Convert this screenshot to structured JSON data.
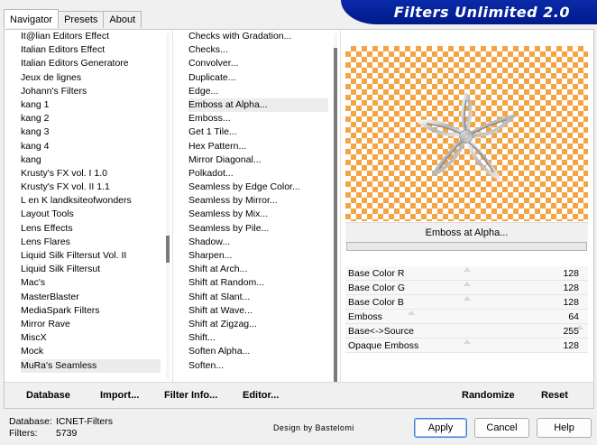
{
  "tabs": [
    "Navigator",
    "Presets",
    "About"
  ],
  "banner_title": "Filters Unlimited 2.0",
  "categories": [
    "It@lian Editors Effect",
    "Italian Editors Effect",
    "Italian Editors Generatore",
    "Jeux de lignes",
    "Johann's Filters",
    "kang 1",
    "kang 2",
    "kang 3",
    "kang 4",
    "kang",
    "Krusty's FX vol. I 1.0",
    "Krusty's FX vol. II 1.1",
    "L en K landksiteofwonders",
    "Layout Tools",
    "Lens Effects",
    "Lens Flares",
    "Liquid Silk Filtersut Vol. II",
    "Liquid Silk Filtersut",
    "Mac's",
    "MasterBlaster",
    "MediaSpark Filters",
    "Mirror Rave",
    "MiscX",
    "Mock",
    "MuRa's Seamless"
  ],
  "selected_category": "MuRa's Seamless",
  "filters": [
    "Checks with Gradation...",
    "Checks...",
    "Convolver...",
    "Duplicate...",
    "Edge...",
    "Emboss at Alpha...",
    "Emboss...",
    "Get 1 Tile...",
    "Hex Pattern...",
    "Mirror Diagonal...",
    "Polkadot...",
    "Seamless by Edge Color...",
    "Seamless by Mirror...",
    "Seamless by Mix...",
    "Seamless by Pile...",
    "Shadow...",
    "Sharpen...",
    "Shift at Arch...",
    "Shift at Random...",
    "Shift at Slant...",
    "Shift at Wave...",
    "Shift at Zigzag...",
    "Shift...",
    "Soften Alpha...",
    "Soften..."
  ],
  "selected_filter": "Emboss at Alpha...",
  "filter_name": "Emboss at Alpha...",
  "params": [
    {
      "label": "Base Color R",
      "value": "128",
      "level": 0.5
    },
    {
      "label": "Base Color G",
      "value": "128",
      "level": 0.5
    },
    {
      "label": "Base Color B",
      "value": "128",
      "level": 0.5
    },
    {
      "label": "Emboss",
      "value": "64",
      "level": 0.25
    },
    {
      "label": "Base<->Source",
      "value": "255",
      "level": 1.0
    },
    {
      "label": "Opaque Emboss",
      "value": "128",
      "level": 0.5
    }
  ],
  "bottom_links": {
    "database": "Database",
    "import": "Import...",
    "filter_info": "Filter Info...",
    "editor": "Editor...",
    "randomize": "Randomize",
    "reset": "Reset"
  },
  "status": {
    "database_label": "Database:",
    "database_value": "ICNET-Filters",
    "filters_label": "Filters:",
    "filters_value": "5739"
  },
  "credit": "Design by Bastelomi",
  "buttons": {
    "apply": "Apply",
    "cancel": "Cancel",
    "help": "Help"
  },
  "colors": {
    "banner": "#0a2aa8",
    "checker": "#f4a443"
  }
}
